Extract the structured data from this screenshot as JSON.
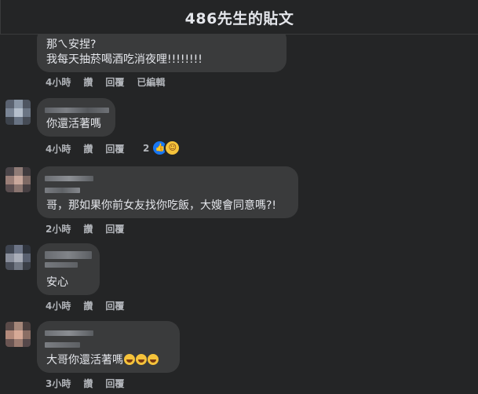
{
  "header": {
    "title": "486先生的貼文"
  },
  "comments": [
    {
      "lines": [
        "那ㄟ安捏?",
        "我每天抽菸喝酒吃消夜哩!!!!!!!!"
      ],
      "time": "4小時",
      "like": "讚",
      "reply": "回覆",
      "edited": "已編輯"
    },
    {
      "lines": [
        "你還活著嗎"
      ],
      "time": "4小時",
      "like": "讚",
      "reply": "回覆",
      "reaction_count": "2",
      "reactions": [
        "like-icon",
        "haha-icon"
      ]
    },
    {
      "lines": [
        "哥，那如果你前女友找你吃飯，大嫂會同意嗎?!"
      ],
      "time": "2小時",
      "like": "讚",
      "reply": "回覆"
    },
    {
      "lines": [
        "安心"
      ],
      "time": "4小時",
      "like": "讚",
      "reply": "回覆"
    },
    {
      "lines": [
        "大哥你還活著嗎"
      ],
      "emojis": [
        "rofl-emoji",
        "rofl-emoji",
        "rofl-emoji"
      ],
      "time": "3小時",
      "like": "讚",
      "reply": "回覆"
    }
  ],
  "colors": {
    "background": "#242526",
    "bubble": "#3a3b3c",
    "text": "#e4e6eb",
    "meta": "#b0b3b8",
    "like_blue": "#1877f2"
  }
}
